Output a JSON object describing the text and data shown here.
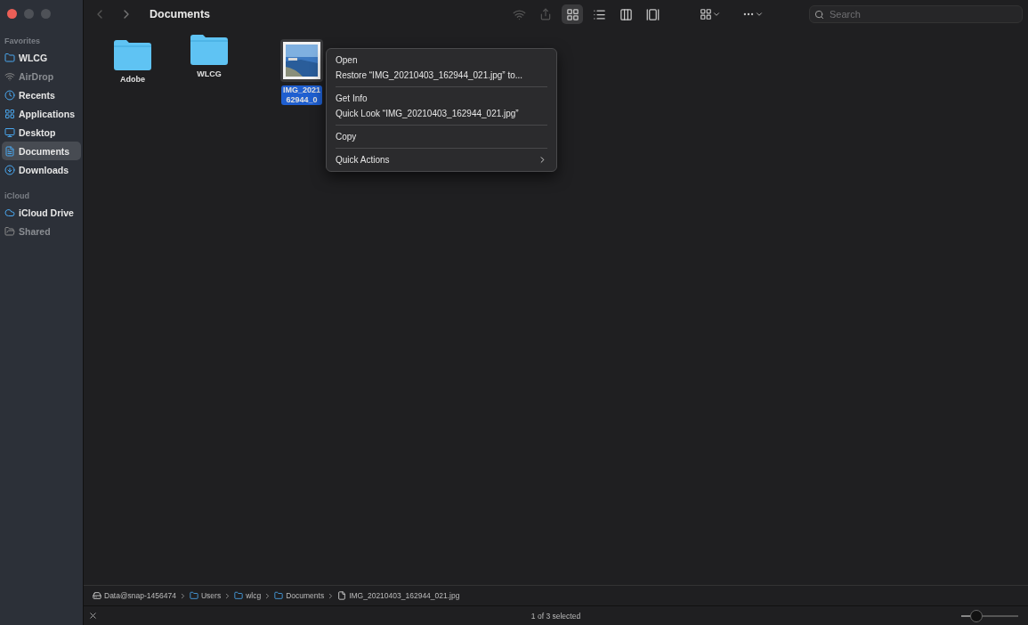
{
  "window": {
    "title": "Documents"
  },
  "sidebar": {
    "sections": [
      {
        "heading": "Favorites",
        "items": [
          {
            "label": "WLCG",
            "selected": false,
            "disabled": false
          },
          {
            "label": "AirDrop",
            "selected": false,
            "disabled": true
          },
          {
            "label": "Recents",
            "selected": false,
            "disabled": false
          },
          {
            "label": "Applications",
            "selected": false,
            "disabled": false
          },
          {
            "label": "Desktop",
            "selected": false,
            "disabled": false
          },
          {
            "label": "Documents",
            "selected": true,
            "disabled": false
          },
          {
            "label": "Downloads",
            "selected": false,
            "disabled": false
          }
        ]
      },
      {
        "heading": "iCloud",
        "items": [
          {
            "label": "iCloud Drive",
            "selected": false,
            "disabled": false
          },
          {
            "label": "Shared",
            "selected": false,
            "disabled": true
          }
        ]
      }
    ]
  },
  "toolbar": {
    "view_modes": [
      {
        "kind": "icons",
        "selected": true
      },
      {
        "kind": "list",
        "selected": false
      },
      {
        "kind": "columns",
        "selected": false
      },
      {
        "kind": "gallery",
        "selected": false
      }
    ],
    "search": {
      "placeholder": "Search"
    }
  },
  "files": [
    {
      "kind": "folder",
      "name_lines": [
        "Adobe"
      ],
      "selected": false
    },
    {
      "kind": "folder",
      "name_lines": [
        "WLCG"
      ],
      "selected": false
    },
    {
      "name_lines": [
        "IMG_2021",
        "62944_0"
      ],
      "selected": true
    }
  ],
  "context_menu": {
    "groups": [
      [
        {
          "label": "Open",
          "submenu": false
        },
        {
          "label": "Restore “IMG_20210403_162944_021.jpg” to...",
          "submenu": false
        }
      ],
      [
        {
          "label": "Get Info",
          "submenu": false
        },
        {
          "label": "Quick Look “IMG_20210403_162944_021.jpg”",
          "submenu": false
        }
      ],
      [
        {
          "label": "Copy",
          "submenu": false
        }
      ],
      [
        {
          "label": "Quick Actions",
          "submenu": true
        }
      ]
    ]
  },
  "path_bar": [
    {
      "label": "Data@snap-1456474",
      "kind": "disk"
    },
    {
      "label": "Users",
      "kind": "folder"
    },
    {
      "label": "wlcg",
      "kind": "folder"
    },
    {
      "label": "Documents",
      "kind": "folder"
    },
    {
      "label": "IMG_20210403_162944_021.jpg",
      "kind": "file"
    }
  ],
  "status_bar": {
    "text": "1 of 3 selected",
    "zoom": {
      "level": 0.25
    }
  }
}
